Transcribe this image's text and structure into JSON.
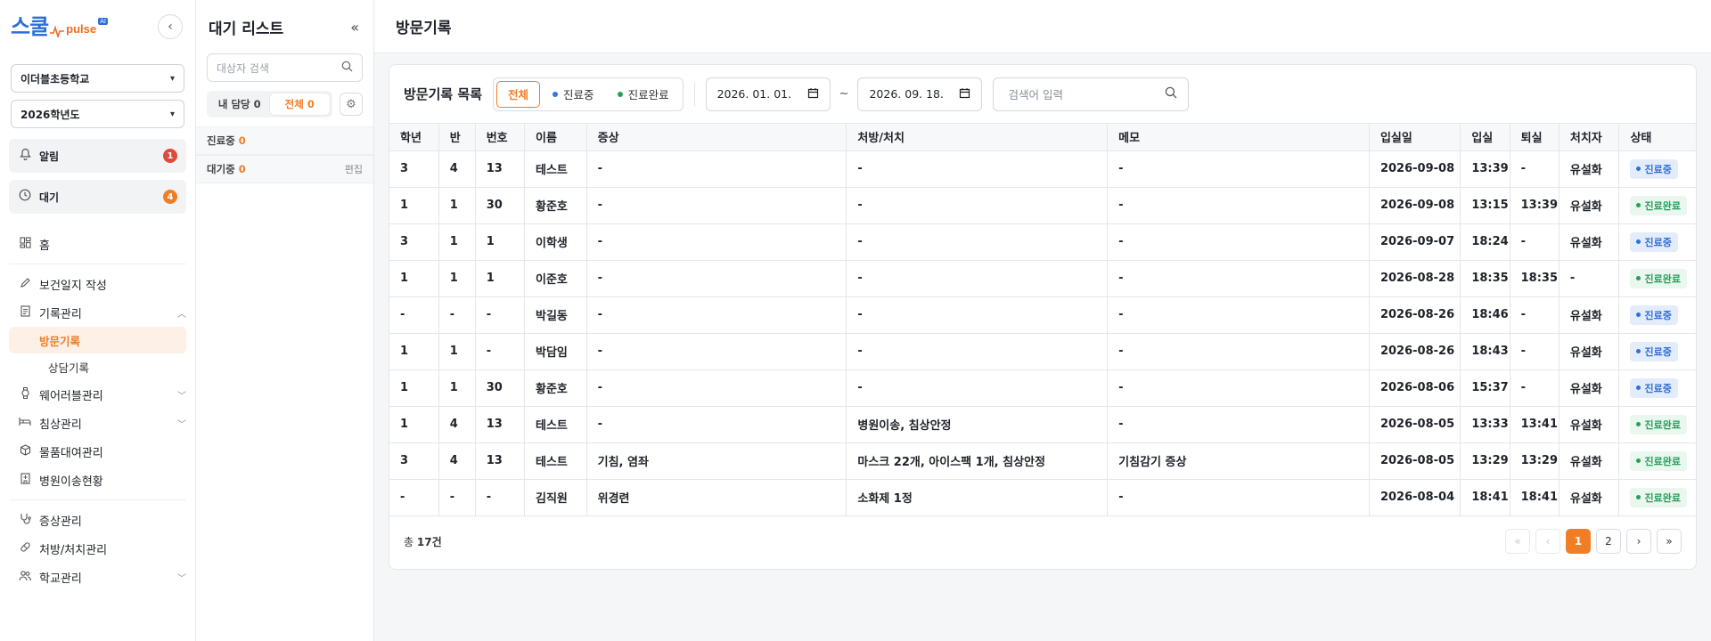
{
  "sidebar": {
    "logo": {
      "mark": "스쿨",
      "pulse": "pulse",
      "badge": "AI"
    },
    "school": "이더블초등학교",
    "year": "2026학년도",
    "status": [
      {
        "label": "알림",
        "count": "1",
        "icon": "bell-icon"
      },
      {
        "label": "대기",
        "count": "4",
        "icon": "clock-icon"
      }
    ],
    "home": "홈",
    "health_log": "보건일지 작성",
    "records": "기록관리",
    "records_sub": [
      "방문기록",
      "상담기록"
    ],
    "wearable": "웨어러블관리",
    "bed": "침상관리",
    "rental": "물품대여관리",
    "hospital": "병원이송현황",
    "symptom": "증상관리",
    "prescription": "처방/처치관리",
    "school_mgmt": "학교관리"
  },
  "wait": {
    "title": "대기 리스트",
    "search_placeholder": "대상자 검색",
    "tab_mine": "내 담당 0",
    "tab_all": "전체 0",
    "in_treatment_label": "진료중",
    "in_treatment_count": "0",
    "waiting_label": "대기중",
    "waiting_count": "0",
    "edit": "편집"
  },
  "main": {
    "title": "방문기록",
    "list_title": "방문기록 목록",
    "filters": {
      "all": "전체",
      "ing": "진료중",
      "done": "진료완료"
    },
    "date_from": "2026. 01. 01.",
    "date_to": "2026. 09. 18.",
    "tilde": "~",
    "search_placeholder": "검색어 입력",
    "columns": [
      "학년",
      "반",
      "번호",
      "이름",
      "증상",
      "처방/처치",
      "메모",
      "입실일",
      "입실",
      "퇴실",
      "처치자",
      "상태"
    ],
    "rows": [
      [
        "3",
        "4",
        "13",
        "테스트",
        "-",
        "-",
        "-",
        "2026-09-08",
        "13:39",
        "-",
        "유설화",
        "진료중"
      ],
      [
        "1",
        "1",
        "30",
        "황준호",
        "-",
        "-",
        "-",
        "2026-09-08",
        "13:15",
        "13:39",
        "유설화",
        "진료완료"
      ],
      [
        "3",
        "1",
        "1",
        "이학생",
        "-",
        "-",
        "-",
        "2026-09-07",
        "18:24",
        "-",
        "유설화",
        "진료중"
      ],
      [
        "1",
        "1",
        "1",
        "이준호",
        "-",
        "-",
        "-",
        "2026-08-28",
        "18:35",
        "18:35",
        "-",
        "진료완료"
      ],
      [
        "-",
        "-",
        "-",
        "박길동",
        "-",
        "-",
        "-",
        "2026-08-26",
        "18:46",
        "-",
        "유설화",
        "진료중"
      ],
      [
        "1",
        "1",
        "-",
        "박담임",
        "-",
        "-",
        "-",
        "2026-08-26",
        "18:43",
        "-",
        "유설화",
        "진료중"
      ],
      [
        "1",
        "1",
        "30",
        "황준호",
        "-",
        "-",
        "-",
        "2026-08-06",
        "15:37",
        "-",
        "유설화",
        "진료중"
      ],
      [
        "1",
        "4",
        "13",
        "테스트",
        "-",
        "병원이송, 침상안정",
        "-",
        "2026-08-05",
        "13:33",
        "13:41",
        "유설화",
        "진료완료"
      ],
      [
        "3",
        "4",
        "13",
        "테스트",
        "기침, 염좌",
        "마스크 22개, 아이스팩 1개, 침상안정",
        "기침감기 증상",
        "2026-08-05",
        "13:29",
        "13:29",
        "유설화",
        "진료완료"
      ],
      [
        "-",
        "-",
        "-",
        "김직원",
        "위경련",
        "소화제 1정",
        "-",
        "2026-08-04",
        "18:41",
        "18:41",
        "유설화",
        "진료완료"
      ]
    ],
    "total_prefix": "총 ",
    "total_count": "17",
    "total_suffix": "건",
    "pages": [
      "1",
      "2"
    ],
    "current_page": "1"
  },
  "colors": {
    "accent": "#f07e26",
    "ing": "#2f6fd8",
    "done": "#2a9d5c"
  }
}
